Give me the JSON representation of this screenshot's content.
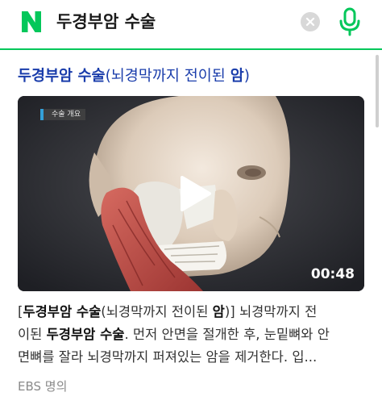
{
  "search": {
    "logo": "N",
    "query": "두경부암 수술",
    "icons": {
      "clear": "clear-icon",
      "mic": "microphone-icon"
    }
  },
  "colors": {
    "brand_green": "#03c75a",
    "title_blue": "#1a3dab",
    "label_accent": "#34a0d8"
  },
  "result": {
    "title_bold": "두경부암 수술",
    "title_paren_start": "(뇌경막까지 전이된 ",
    "title_bold_end": "암",
    "title_paren_close": ")",
    "video": {
      "label": "수술 개요",
      "duration": "00:48",
      "play_icon": "play-icon"
    },
    "snippet": {
      "l1_open": "[",
      "l1_bold": "두경부암 수술",
      "l1_mid": "(뇌경막까지 전이된 ",
      "l1_bold2": "암",
      "l1_close": ")]",
      "l1_tail": " 뇌경막까지 전",
      "l2_head": "이된 ",
      "l2_bold": "두경부암 수술",
      "l2_tail": ". 먼저 안면을 절개한 후, 눈밑뼈와 안",
      "l3": "면뼈를 잘라 뇌경막까지 퍼져있는 암을 제거한다. 입..."
    },
    "source": "EBS 명의"
  }
}
